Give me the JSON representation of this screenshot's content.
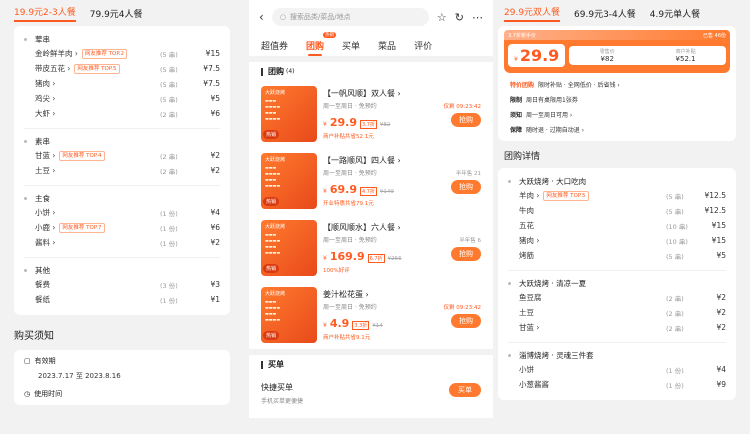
{
  "left": {
    "tabs": [
      "19.9元2-3人餐",
      "79.9元4人餐"
    ],
    "groups": [
      {
        "title": "荤串",
        "items": [
          {
            "name": "金岭鲜羊肉 ›",
            "badge": "网友推荐 TOP.2",
            "qty": "(5 串)",
            "price": "¥15"
          },
          {
            "name": "带皮五花 ›",
            "badge": "网友推荐 TOP.5",
            "qty": "(5 串)",
            "price": "¥7.5"
          },
          {
            "name": "猪肉 ›",
            "badge": "",
            "qty": "(5 串)",
            "price": "¥7.5"
          },
          {
            "name": "鸡尖 ›",
            "badge": "",
            "qty": "(5 串)",
            "price": "¥5"
          },
          {
            "name": "大虾 ›",
            "badge": "",
            "qty": "(2 串)",
            "price": "¥6"
          }
        ]
      },
      {
        "title": "素串",
        "items": [
          {
            "name": "甘蓝 ›",
            "badge": "网友推荐 TOP.4",
            "qty": "(2 串)",
            "price": "¥2"
          },
          {
            "name": "土豆 ›",
            "badge": "",
            "qty": "(2 串)",
            "price": "¥2"
          }
        ]
      },
      {
        "title": "主食",
        "items": [
          {
            "name": "小饼 ›",
            "badge": "",
            "qty": "(1 份)",
            "price": "¥4"
          },
          {
            "name": "小鹿 ›",
            "badge": "网友推荐 TOP.7",
            "qty": "(1 份)",
            "price": "¥6"
          },
          {
            "name": "酱料 ›",
            "badge": "",
            "qty": "(1 份)",
            "price": "¥2"
          }
        ]
      },
      {
        "title": "其他",
        "items": [
          {
            "name": "餐费",
            "badge": "",
            "qty": "(3 份)",
            "price": "¥3"
          },
          {
            "name": "餐纸",
            "badge": "",
            "qty": "(1 份)",
            "price": "¥1"
          }
        ]
      }
    ],
    "notice": {
      "title": "购买须知",
      "valid_label": "有效期",
      "valid_value": "2023.7.17 至 2023.8.16",
      "use_label": "使用时间"
    }
  },
  "mid": {
    "search_placeholder": "搜索品类/菜品/地点",
    "nav": [
      "超值券",
      "团购",
      "买单",
      "菜品",
      "评价"
    ],
    "hot": "热销",
    "section": "团购",
    "section_count": "(4)",
    "deals": [
      {
        "name": "【一帆风顺】双人餐 ›",
        "sub": "周一至周日 · 免预约",
        "price": "29.9",
        "disc": "3.7折",
        "old": "¥82",
        "save": "商户补贴共省52.1元",
        "countdown": "仅剩 09:23:42",
        "sold": "",
        "buy": "抢购",
        "thumb_title": "大跃烧烤"
      },
      {
        "name": "【一路顺风】四人餐 ›",
        "sub": "周一至周日 · 免预约",
        "price": "69.9",
        "disc": "4.7折",
        "old": "¥149",
        "save": "开业特惠共省79.1元",
        "countdown": "",
        "sold": "半年售 21",
        "buy": "抢购",
        "thumb_title": "大跃烧烤"
      },
      {
        "name": "【顺风顺水】六人餐 ›",
        "sub": "周一至周日 · 免预约",
        "price": "169.9",
        "disc": "6.7折",
        "old": "¥256",
        "save": "100%好评",
        "countdown": "",
        "sold": "半年售 6",
        "buy": "抢购",
        "thumb_title": "大跃烧烤"
      },
      {
        "name": "姜汁松花蛋 ›",
        "sub": "周一至周日 · 免预约",
        "price": "4.9",
        "disc": "3.3折",
        "old": "¥14",
        "save": "商户补贴共省9.1元",
        "countdown": "仅剩 09:23:42",
        "sold": "",
        "buy": "抢购",
        "thumb_title": "大跃烧烤"
      }
    ],
    "maidan": "买单",
    "quick": {
      "title": "快捷买单",
      "sub": "手机买单更便捷",
      "btn": "买单"
    }
  },
  "right": {
    "tabs": [
      "29.9元双人餐",
      "69.9元3-4人餐",
      "4.9元单人餐"
    ],
    "hero": {
      "bar_left": "3.7折新手价",
      "bar_right": "已售 46份",
      "symbol": "¥",
      "price": "29.9",
      "c1_label": "零售价",
      "c1_val": "¥82",
      "c2_label": "商户补贴",
      "c2_val": "¥52.1"
    },
    "rows": [
      {
        "k": "特价团购",
        "v": "限时补贴 · 全网低价 · 后省钱 ›"
      },
      {
        "k": "限制",
        "v": "周日有桌限用1张券"
      },
      {
        "k": "须知",
        "v": "周一至周日可用 ›"
      },
      {
        "k": "保障",
        "v": "随时退 · 过期自动退 ›"
      }
    ],
    "detail_title": "团购详情",
    "groups": [
      {
        "title": "大跃烧烤 · 大口吃肉",
        "items": [
          {
            "name": "羊肉 ›",
            "badge": "网友推荐 TOP.5",
            "qty": "(5 串)",
            "price": "¥12.5"
          },
          {
            "name": "牛肉",
            "badge": "",
            "qty": "(5 串)",
            "price": "¥12.5"
          },
          {
            "name": "五花",
            "badge": "",
            "qty": "(10 串)",
            "price": "¥15"
          },
          {
            "name": "猪肉 ›",
            "badge": "",
            "qty": "(10 串)",
            "price": "¥15"
          },
          {
            "name": "烤筋",
            "badge": "",
            "qty": "(5 串)",
            "price": "¥5"
          }
        ]
      },
      {
        "title": "大跃烧烤 · 清凉一夏",
        "items": [
          {
            "name": "鱼豆腐",
            "badge": "",
            "qty": "(2 串)",
            "price": "¥2"
          },
          {
            "name": "土豆",
            "badge": "",
            "qty": "(2 串)",
            "price": "¥2"
          },
          {
            "name": "甘蓝 ›",
            "badge": "",
            "qty": "(2 串)",
            "price": "¥2"
          }
        ]
      },
      {
        "title": "淄博烧烤 · 灵魂三件套",
        "items": [
          {
            "name": "小饼",
            "badge": "",
            "qty": "(1 份)",
            "price": "¥4"
          },
          {
            "name": "小葱酱酱",
            "badge": "",
            "qty": "(1 份)",
            "price": "¥9"
          }
        ]
      }
    ]
  }
}
